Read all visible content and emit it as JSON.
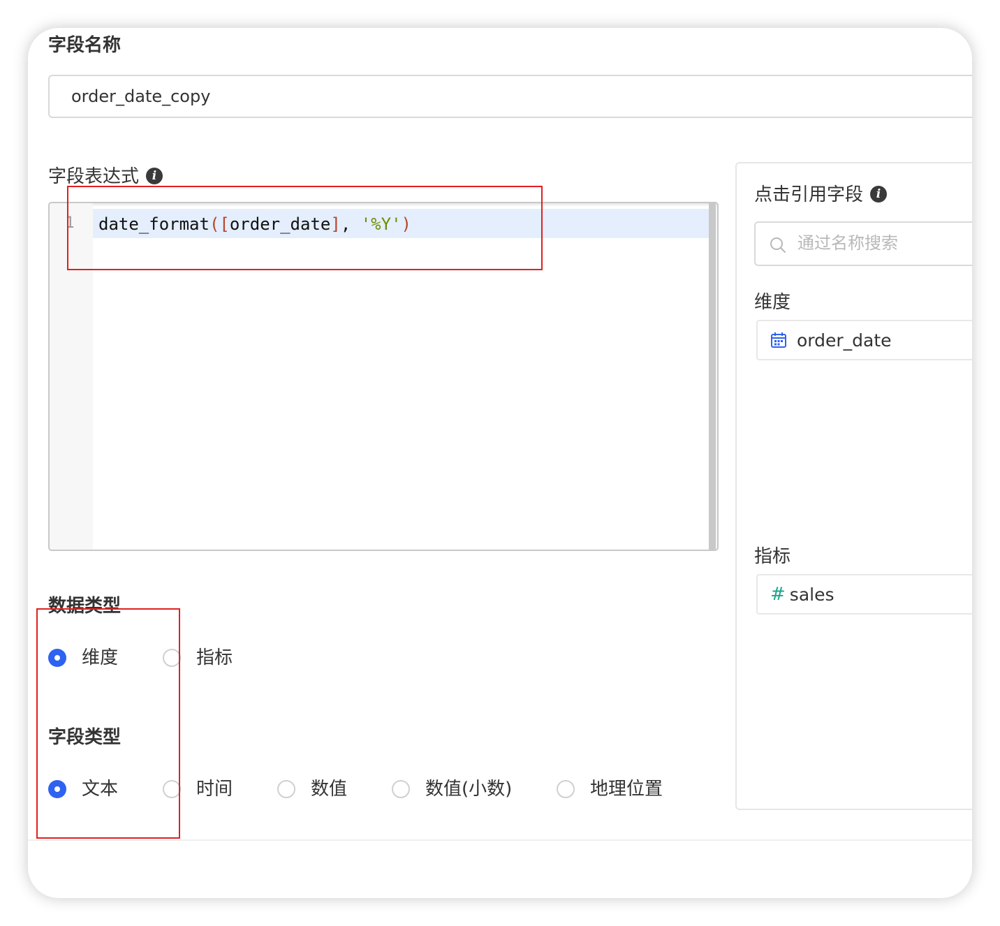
{
  "form": {
    "field_name_label": "字段名称",
    "field_name_value": "order_date_copy",
    "expression_label": "字段表达式",
    "info_glyph": "i"
  },
  "editor": {
    "line_number": "1",
    "code_tokens": {
      "func": "date_format",
      "open_paren": "(",
      "open_bracket": "[",
      "field": "order_date",
      "close_bracket": "]",
      "comma": ", ",
      "string": "'%Y'",
      "close_paren": ")"
    },
    "colors": {
      "bracket": "#b8452c",
      "string": "#6a8e00",
      "active_line": "#e4eefc"
    }
  },
  "data_type": {
    "label": "数据类型",
    "options": [
      {
        "label": "维度",
        "checked": true
      },
      {
        "label": "指标",
        "checked": false
      }
    ]
  },
  "field_type": {
    "label": "字段类型",
    "options": [
      {
        "label": "文本",
        "checked": true
      },
      {
        "label": "时间",
        "checked": false
      },
      {
        "label": "数值",
        "checked": false
      },
      {
        "label": "数值(小数)",
        "checked": false
      },
      {
        "label": "地理位置",
        "checked": false
      }
    ]
  },
  "reference_panel": {
    "title": "点击引用字段",
    "search_placeholder": "通过名称搜索",
    "dimension_label": "维度",
    "dimension_fields": [
      {
        "name": "order_date",
        "icon": "calendar-icon"
      }
    ],
    "measure_label": "指标",
    "measure_fields": [
      {
        "name": "sales",
        "icon": "hash-icon",
        "glyph": "#"
      }
    ]
  },
  "accent_color": "#2e62f0",
  "annotation_color": "#e02020"
}
